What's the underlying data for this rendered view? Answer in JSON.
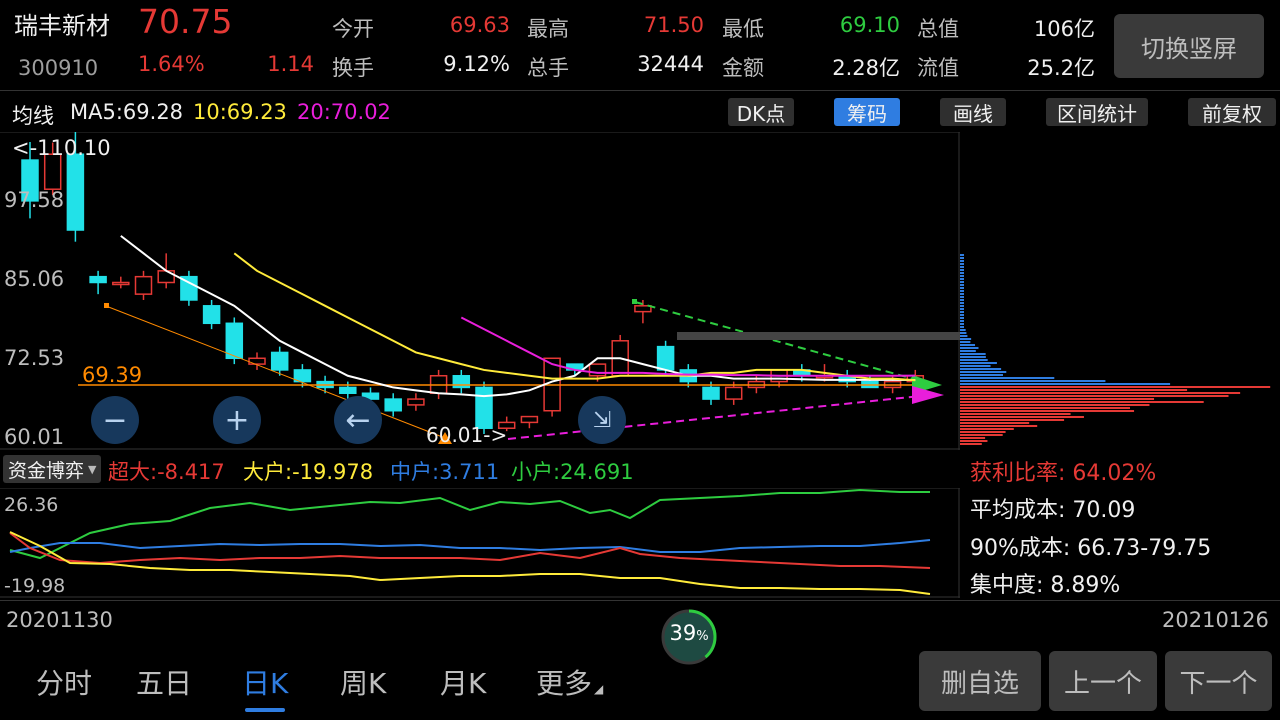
{
  "stock": {
    "name": "瑞丰新材",
    "code": "300910",
    "price": "70.75",
    "change_pct": "1.64%",
    "change": "1.14"
  },
  "quote": {
    "open_label": "今开",
    "open": "69.63",
    "high_label": "最高",
    "high": "71.50",
    "low_label": "最低",
    "low": "69.10",
    "mcap_label": "总值",
    "mcap": "106亿",
    "turnover_label": "换手",
    "turnover": "9.12%",
    "volume_label": "总手",
    "volume": "32444",
    "amount_label": "金额",
    "amount": "2.28亿",
    "float_label": "流值",
    "float": "25.2亿"
  },
  "switch_button": "切换竖屏",
  "ma": {
    "title": "均线",
    "ma5": "MA5:69.28",
    "ma10": "10:69.23",
    "ma20": "20:70.02"
  },
  "toolbar": {
    "dk": "DK点",
    "chips": "筹码",
    "draw": "画线",
    "stats": "区间统计",
    "adjust": "前复权"
  },
  "kline": {
    "max_label": "<-110.10",
    "min_label": "60.01->",
    "line_label": "69.39",
    "y_ticks": [
      "97.58",
      "85.06",
      "72.53",
      "60.01"
    ],
    "candles": [
      [
        107,
        100,
        110.1,
        97
      ],
      [
        102,
        108,
        110,
        101
      ],
      [
        108,
        95,
        112,
        93
      ],
      [
        87,
        86,
        88,
        84
      ],
      [
        86,
        86,
        87,
        85
      ],
      [
        84,
        87,
        88,
        83
      ],
      [
        86,
        88,
        91,
        85
      ],
      [
        87,
        83,
        88,
        82
      ],
      [
        82,
        79,
        83,
        78
      ],
      [
        79,
        73,
        80,
        72
      ],
      [
        72,
        73,
        74,
        71
      ],
      [
        74,
        71,
        75,
        70
      ],
      [
        71,
        69,
        72,
        68
      ],
      [
        69,
        68,
        70,
        67
      ],
      [
        68,
        67,
        69,
        66
      ],
      [
        67,
        66,
        68,
        65
      ],
      [
        66,
        64,
        67,
        63
      ],
      [
        65,
        66,
        67,
        64
      ],
      [
        67,
        70,
        71,
        66
      ],
      [
        70,
        68,
        71,
        67
      ],
      [
        68,
        61,
        69,
        60.01
      ],
      [
        61,
        62,
        63,
        60.5
      ],
      [
        62,
        63,
        63,
        61
      ],
      [
        64,
        73,
        73,
        63
      ],
      [
        72,
        71,
        72,
        70
      ],
      [
        70,
        72,
        72,
        69
      ],
      [
        70,
        76,
        77,
        70
      ],
      [
        81,
        82,
        83,
        79
      ],
      [
        75,
        71,
        76,
        70
      ],
      [
        71,
        69,
        72,
        68
      ],
      [
        68,
        66,
        69,
        65
      ],
      [
        66,
        68,
        69,
        65
      ],
      [
        68,
        69,
        70,
        67
      ],
      [
        69,
        71,
        71,
        68
      ],
      [
        71,
        70,
        72,
        69
      ],
      [
        70,
        70,
        72,
        69
      ],
      [
        70,
        69,
        71,
        68
      ],
      [
        69,
        68,
        70,
        68
      ],
      [
        68,
        69,
        70,
        67
      ],
      [
        69,
        70,
        71,
        68
      ]
    ],
    "ma5": [
      null,
      null,
      null,
      null,
      94,
      91,
      88,
      86,
      84,
      82,
      79,
      76,
      74,
      72,
      70,
      69,
      68,
      67.5,
      67,
      66.8,
      66.5,
      66.8,
      67.5,
      69,
      70,
      73,
      73,
      72,
      71,
      70,
      70,
      69.5,
      69.5,
      69.5,
      69.4,
      69.3,
      69.3,
      69.3,
      69.3,
      69.28
    ],
    "ma10": [
      null,
      null,
      null,
      null,
      null,
      null,
      null,
      null,
      null,
      91,
      88,
      86,
      84,
      82,
      80,
      78,
      76,
      74,
      73,
      72,
      71,
      70.5,
      70,
      69.5,
      69.5,
      69.5,
      70,
      70,
      70,
      70,
      70.5,
      70.5,
      71,
      71,
      71,
      70.5,
      70,
      69.5,
      69.5,
      69.23
    ],
    "ma20": [
      null,
      null,
      null,
      null,
      null,
      null,
      null,
      null,
      null,
      null,
      null,
      null,
      null,
      null,
      null,
      null,
      null,
      null,
      null,
      80,
      78,
      76,
      74,
      72,
      71,
      70.5,
      70.5,
      70.5,
      70.3,
      70.2,
      70.2,
      70.1,
      70.1,
      70,
      70,
      70,
      70,
      70,
      70,
      70.02
    ]
  },
  "fund": {
    "selector": "资金博弈",
    "super": "超大:-8.417",
    "large": "大户:-19.978",
    "mid": "中户:3.711",
    "small": "小户:24.691",
    "y_top": "26.36",
    "y_bottom": "-19.98",
    "colors": {
      "super": "#e53935",
      "large": "#ffeb3b",
      "mid": "#2f7de1",
      "small": "#2ecc40"
    }
  },
  "chips": {
    "profit": "获利比率: 64.02%",
    "avg_cost": "平均成本: 70.09",
    "cost90": "90%成本: 66.73-79.75",
    "concentration": "集中度: 8.89%"
  },
  "dates": {
    "start": "20201130",
    "end": "20210126"
  },
  "progress": {
    "label": "39",
    "unit": "%",
    "value": 0.39
  },
  "tabs": [
    "分时",
    "五日",
    "日K",
    "周K",
    "月K",
    "更多"
  ],
  "active_tab": "日K",
  "buttons": {
    "delete": "删自选",
    "prev": "上一个",
    "next": "下一个"
  }
}
